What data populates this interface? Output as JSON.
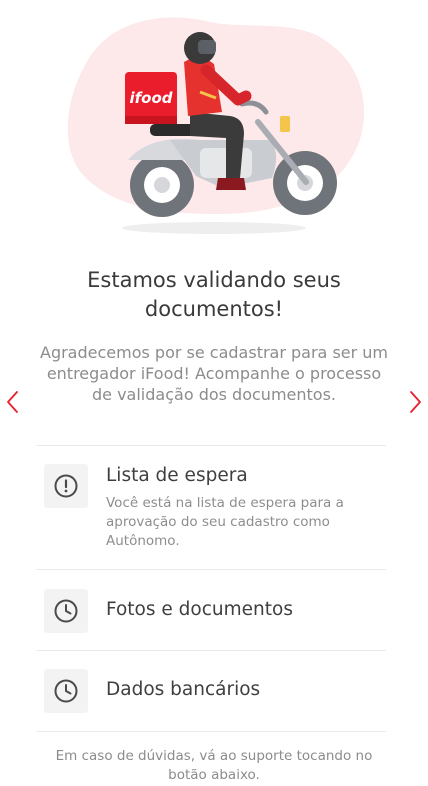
{
  "illustration": {
    "brand_text": "ifood",
    "accent_color": "#ea1d2c",
    "blob_color": "#fde8ea"
  },
  "title": "Estamos validando seus documentos!",
  "subtitle": "Agradecemos por se cadastrar para ser um entregador iFood! Acompanhe o processo de validação dos documentos.",
  "nav": {
    "prev_icon": "chevron-left-icon",
    "next_icon": "chevron-right-icon",
    "arrow_color": "#ea1d2c"
  },
  "steps": [
    {
      "icon": "alert-circle-icon",
      "title": "Lista de espera",
      "description": "Você está na lista de espera para a aprovação do seu cadastro como Autônomo."
    },
    {
      "icon": "clock-icon",
      "title": "Fotos e documentos"
    },
    {
      "icon": "clock-icon",
      "title": "Dados bancários"
    }
  ],
  "footer_text": "Em caso de dúvidas, vá ao suporte tocando no botão abaixo."
}
